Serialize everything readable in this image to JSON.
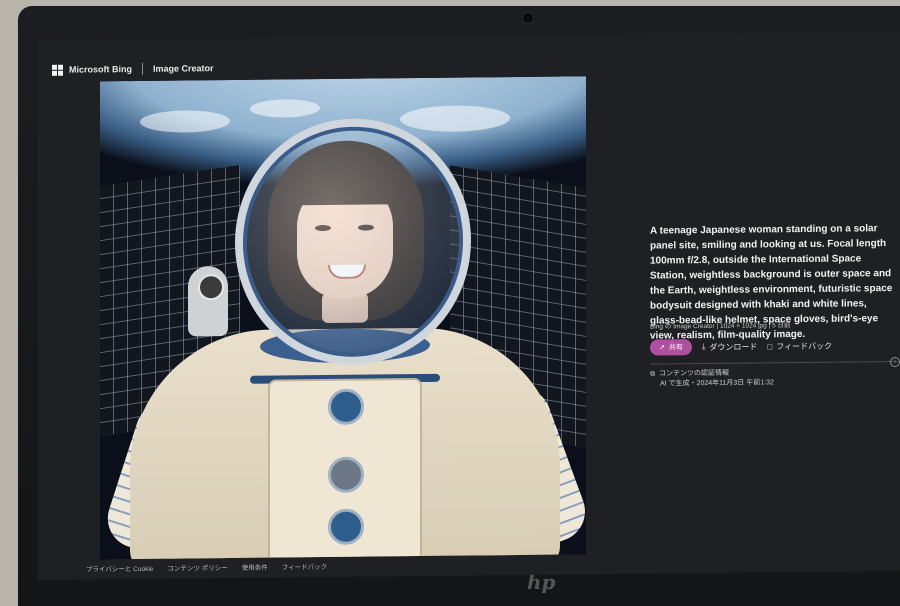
{
  "header": {
    "brand": "Microsoft Bing",
    "product": "Image Creator"
  },
  "image": {
    "alt_icons": [
      "earth",
      "solar-panels",
      "astronaut"
    ]
  },
  "details": {
    "prompt": "A teenage Japanese woman standing on a solar panel site, smiling and looking at us. Focal length 100mm f/2.8, outside the International Space Station, weightless background is outer space and the Earth, weightless environment, futuristic space bodysuit designed with khaki and white lines, glass-bead-like helmet, space gloves, bird's-eye view, realism, film-quality image.",
    "meta": "Bing の Image Creator  |  1024 × 1024 jpg  |  5 日前"
  },
  "actions": {
    "share": "共有",
    "download": "ダウンロード",
    "feedback": "フィードバック"
  },
  "credentials": {
    "title": "コンテンツの認証情報",
    "subtitle": "AI で生成・2024年11月3日 午前1:32"
  },
  "footer": {
    "links": [
      "プライバシーと Cookie",
      "コンテンツ ポリシー",
      "使用条件",
      "フィードバック"
    ]
  },
  "device": {
    "logo": "hp"
  },
  "colors": {
    "share_button": "#b04ea0",
    "page_background": "#1f2023"
  }
}
